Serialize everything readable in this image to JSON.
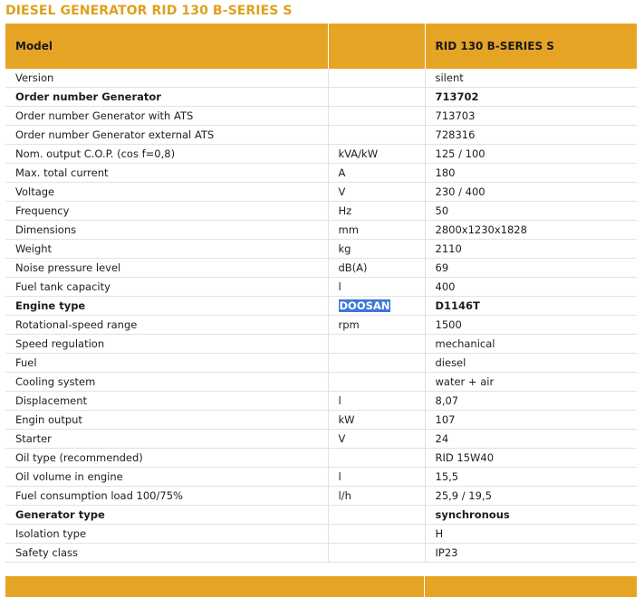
{
  "page": {
    "title": "DIESEL GENERATOR RID 130 B-SERIES S"
  },
  "colors": {
    "accent": "#e5a424",
    "title": "#e0a01a",
    "highlight": "#3d78d8"
  },
  "table": {
    "header": [
      "Model",
      "",
      "RID 130 B-SERIES S"
    ],
    "rows": [
      {
        "label": "Version",
        "unit": "",
        "value": "silent",
        "bold": false
      },
      {
        "label": "Order number Generator",
        "unit": "",
        "value": "713702",
        "bold": true
      },
      {
        "label": "Order number Generator with ATS",
        "unit": "",
        "value": "713703",
        "bold": false
      },
      {
        "label": "Order number Generator external ATS",
        "unit": "",
        "value": "728316",
        "bold": false
      },
      {
        "label": "Nom. output C.O.P. (cos f=0,8)",
        "unit": "kVA/kW",
        "value": "125 / 100",
        "bold": false
      },
      {
        "label": "Max. total current",
        "unit": "A",
        "value": "180",
        "bold": false
      },
      {
        "label": "Voltage",
        "unit": "V",
        "value": "230 / 400",
        "bold": false
      },
      {
        "label": "Frequency",
        "unit": "Hz",
        "value": "50",
        "bold": false
      },
      {
        "label": "Dimensions",
        "unit": "mm",
        "value": "2800x1230x1828",
        "bold": false
      },
      {
        "label": "Weight",
        "unit": "kg",
        "value": "2110",
        "bold": false
      },
      {
        "label": "Noise pressure level",
        "unit": "dB(A)",
        "value": "69",
        "bold": false
      },
      {
        "label": "Fuel tank capacity",
        "unit": "l",
        "value": "400",
        "bold": false
      },
      {
        "label": "Engine type",
        "unit": "DOOSAN",
        "value": "D1146T",
        "bold": true,
        "unit_highlighted": true
      },
      {
        "label": "Rotational-speed range",
        "unit": "rpm",
        "value": "1500",
        "bold": false
      },
      {
        "label": "Speed regulation",
        "unit": "",
        "value": "mechanical",
        "bold": false
      },
      {
        "label": "Fuel",
        "unit": "",
        "value": "diesel",
        "bold": false
      },
      {
        "label": "Cooling system",
        "unit": "",
        "value": "water + air",
        "bold": false
      },
      {
        "label": "Displacement",
        "unit": "l",
        "value": "8,07",
        "bold": false
      },
      {
        "label": "Engin output",
        "unit": "kW",
        "value": "107",
        "bold": false
      },
      {
        "label": "Starter",
        "unit": "V",
        "value": "24",
        "bold": false
      },
      {
        "label": "Oil type (recommended)",
        "unit": "",
        "value": "RID 15W40",
        "bold": false
      },
      {
        "label": "Oil volume in engine",
        "unit": "l",
        "value": "15,5",
        "bold": false
      },
      {
        "label": "Fuel consumption load 100/75%",
        "unit": "l/h",
        "value": "25,9 / 19,5",
        "bold": false
      },
      {
        "label": "Generator type",
        "unit": "",
        "value": "synchronous",
        "bold": true
      },
      {
        "label": "Isolation type",
        "unit": "",
        "value": "H",
        "bold": false
      },
      {
        "label": "Safety class",
        "unit": "",
        "value": "IP23",
        "bold": false
      }
    ]
  }
}
